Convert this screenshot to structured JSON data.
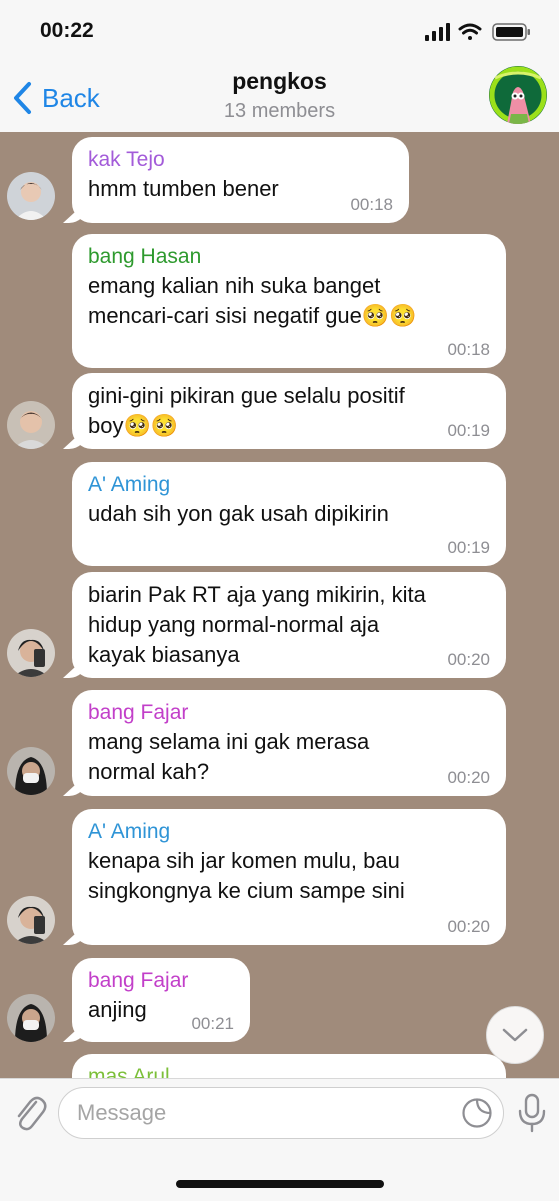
{
  "status_bar": {
    "time": "00:22"
  },
  "header": {
    "back_label": "Back",
    "title": "pengkos",
    "subtitle": "13 members"
  },
  "messages": [
    {
      "sender": "kak Tejo",
      "sender_color": "#a35bd9",
      "text": "hmm tumben bener",
      "time": "00:18"
    },
    {
      "sender": "bang Hasan",
      "sender_color": "#2e9a2e",
      "text": "emang kalian nih suka banget\nmencari-cari sisi negatif gue🥺🥺",
      "time": "00:18"
    },
    {
      "sender": "",
      "text": "gini-gini pikiran gue selalu positif\nboy🥺🥺",
      "time": "00:19"
    },
    {
      "sender": "A' Aming",
      "sender_color": "#2f94d6",
      "text": "udah sih yon gak usah dipikirin",
      "time": "00:19"
    },
    {
      "sender": "",
      "text": "biarin Pak RT aja yang mikirin, kita\nhidup yang normal-normal aja\nkayak biasanya",
      "time": "00:20"
    },
    {
      "sender": "bang Fajar",
      "sender_color": "#c23fc9",
      "text": "mang selama ini gak merasa\nnormal kah?",
      "time": "00:20"
    },
    {
      "sender": "A' Aming",
      "sender_color": "#2f94d6",
      "text": "kenapa sih jar komen mulu, bau\nsingkongnya ke cium sampe sini",
      "time": "00:20"
    },
    {
      "sender": "bang Fajar",
      "sender_color": "#c23fc9",
      "text": "anjing",
      "time": "00:21"
    },
    {
      "sender": "mas Arul",
      "sender_color": "#7cbf3a",
      "text": "",
      "time": ""
    }
  ],
  "input": {
    "placeholder": "Message"
  },
  "colors": {
    "accent": "#1f86e6",
    "chat_background": "#a08b7b",
    "bubble": "#ffffff"
  },
  "icons": [
    "back-chevron-icon",
    "signal-icon",
    "wifi-icon",
    "battery-icon",
    "attach-icon",
    "sticker-icon",
    "mic-icon",
    "chevron-down-icon"
  ]
}
